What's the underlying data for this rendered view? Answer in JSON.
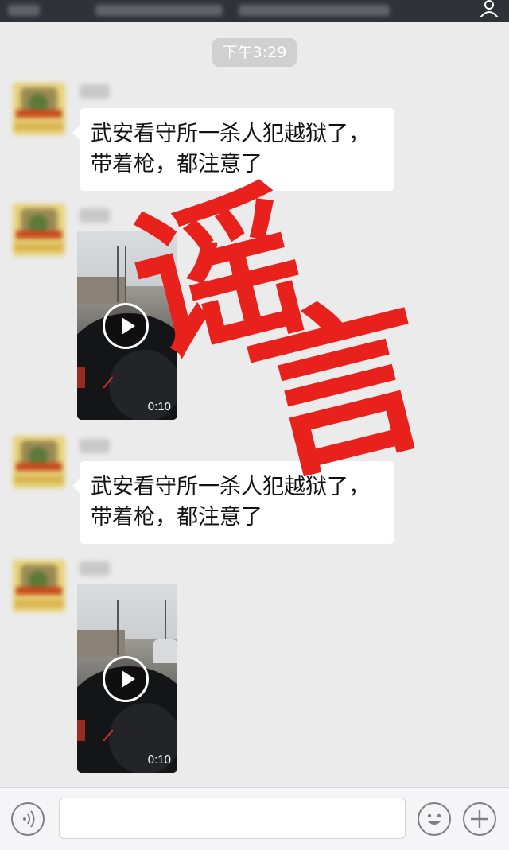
{
  "chat": {
    "timestamp": "下午3:29",
    "messages": [
      {
        "type": "text",
        "line1": "武安看守所一杀人犯越狱了，",
        "line2": "带着枪，都注意了"
      },
      {
        "type": "video",
        "duration": "0:10"
      },
      {
        "type": "text",
        "line1": "武安看守所一杀人犯越狱了，",
        "line2": "带着枪，都注意了"
      },
      {
        "type": "video",
        "duration": "0:10"
      }
    ]
  },
  "overlay": {
    "stamp_char1": "谣",
    "stamp_char2": "言",
    "color": "#e8211c"
  },
  "input_bar": {
    "voice_icon": "voice-icon",
    "emoji_icon": "emoji-icon",
    "plus_icon": "plus-icon"
  },
  "colors": {
    "background": "#ebebeb",
    "bubble": "#ffffff",
    "topbar": "#2f3237"
  }
}
